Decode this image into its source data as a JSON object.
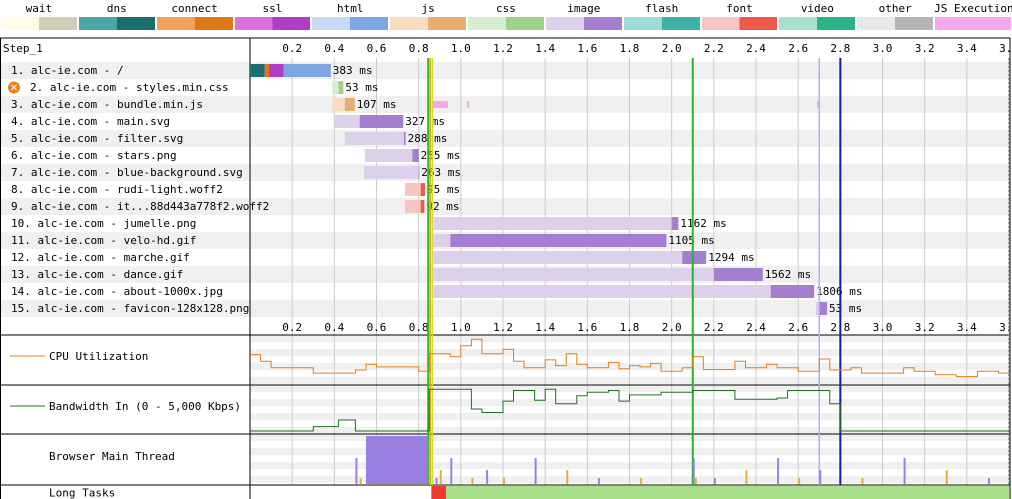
{
  "legend": [
    {
      "label": "wait",
      "colors": [
        "#fdfde7",
        "#cfcfb6"
      ]
    },
    {
      "label": "dns",
      "colors": [
        "#48a6a6",
        "#1b6f6f"
      ]
    },
    {
      "label": "connect",
      "colors": [
        "#f5a05a",
        "#e07614"
      ]
    },
    {
      "label": "ssl",
      "colors": [
        "#e06ee0",
        "#b23cc8"
      ]
    },
    {
      "label": "html",
      "colors": [
        "#c7d9f5",
        "#7ea6e0"
      ]
    },
    {
      "label": "js",
      "colors": [
        "#f7dcbf",
        "#e6ae72"
      ]
    },
    {
      "label": "css",
      "colors": [
        "#d7ecd0",
        "#9fd08e"
      ]
    },
    {
      "label": "image",
      "colors": [
        "#ddd0ea",
        "#a47fd0"
      ]
    },
    {
      "label": "flash",
      "colors": [
        "#9fdcd6",
        "#3fb0a4"
      ]
    },
    {
      "label": "font",
      "colors": [
        "#f8c6c0",
        "#ef5a48"
      ]
    },
    {
      "label": "video",
      "colors": [
        "#a8e0cc",
        "#2db38a"
      ]
    },
    {
      "label": "other",
      "colors": [
        "#e8e8e8",
        "#b5b5b5"
      ]
    },
    {
      "label": "JS Execution",
      "colors": [
        "#f6a6f0",
        "#f6a6f0"
      ]
    }
  ],
  "step_label": "Step_1",
  "chart_data": {
    "type": "waterfall",
    "x_unit": "s",
    "xlim": [
      0,
      3.6
    ],
    "ticks": [
      "0.2",
      "0.4",
      "0.6",
      "0.8",
      "1.0",
      "1.2",
      "1.4",
      "1.6",
      "1.8",
      "2.0",
      "2.2",
      "2.4",
      "2.6",
      "2.8",
      "3.0",
      "3.2",
      "3.4",
      "3.6"
    ],
    "tick_values": [
      0.2,
      0.4,
      0.6,
      0.8,
      1.0,
      1.2,
      1.4,
      1.6,
      1.8,
      2.0,
      2.2,
      2.4,
      2.6,
      2.8,
      3.0,
      3.2,
      3.4,
      3.6
    ],
    "markers": [
      {
        "name": "start-render",
        "time": 0.845,
        "color": "#28c028"
      },
      {
        "name": "first-paint",
        "time": 0.865,
        "color": "#c8e030"
      },
      {
        "name": "dom-interactive",
        "time": 0.855,
        "color": "#e8a020"
      },
      {
        "name": "dom-content-loaded",
        "time": 2.1,
        "color": "#28b428"
      },
      {
        "name": "on-load",
        "time": 2.7,
        "color": "#b0b0f0"
      },
      {
        "name": "document-complete",
        "time": 2.8,
        "color": "#1818a8"
      },
      {
        "name": "end",
        "time": 3.6,
        "color": "#888888"
      }
    ],
    "requests": [
      {
        "label": "1. alc-ie.com - /",
        "type": "html",
        "segments": [
          {
            "kind": "dns",
            "s": 0.0,
            "e": 0.07
          },
          {
            "kind": "connect",
            "s": 0.07,
            "e": 0.09
          },
          {
            "kind": "ssl",
            "s": 0.09,
            "e": 0.16
          },
          {
            "kind": "wait",
            "s": 0.16,
            "e": 0.16
          },
          {
            "kind": "recv",
            "s": 0.16,
            "e": 0.383
          }
        ],
        "ms": "383 ms",
        "end": 0.383,
        "blocked": false
      },
      {
        "label": "2. alc-ie.com - styles.min.css",
        "type": "css",
        "segments": [
          {
            "kind": "wait",
            "s": 0.39,
            "e": 0.42
          },
          {
            "kind": "recv",
            "s": 0.42,
            "e": 0.443
          }
        ],
        "ms": "53 ms",
        "end": 0.443,
        "blocked": true
      },
      {
        "label": "3. alc-ie.com - bundle.min.js",
        "type": "js",
        "segments": [
          {
            "kind": "wait",
            "s": 0.39,
            "e": 0.45
          },
          {
            "kind": "recv",
            "s": 0.45,
            "e": 0.497
          }
        ],
        "ms": "107 ms",
        "end": 0.497,
        "blocked": false
      },
      {
        "label": "4. alc-ie.com - main.svg",
        "type": "image",
        "segments": [
          {
            "kind": "wait",
            "s": 0.4,
            "e": 0.52
          },
          {
            "kind": "recv",
            "s": 0.52,
            "e": 0.727
          }
        ],
        "ms": "327 ms",
        "end": 0.727,
        "blocked": false
      },
      {
        "label": "5. alc-ie.com - filter.svg",
        "type": "image",
        "segments": [
          {
            "kind": "wait",
            "s": 0.45,
            "e": 0.73
          },
          {
            "kind": "recv",
            "s": 0.73,
            "e": 0.738
          }
        ],
        "ms": "288 ms",
        "end": 0.738,
        "blocked": false
      },
      {
        "label": "6. alc-ie.com - stars.png",
        "type": "image",
        "segments": [
          {
            "kind": "wait",
            "s": 0.545,
            "e": 0.77
          },
          {
            "kind": "recv",
            "s": 0.77,
            "e": 0.8
          }
        ],
        "ms": "255 ms",
        "end": 0.8,
        "blocked": false
      },
      {
        "label": "7. alc-ie.com - blue-background.svg",
        "type": "image",
        "segments": [
          {
            "kind": "wait",
            "s": 0.54,
            "e": 0.8
          },
          {
            "kind": "recv",
            "s": 0.8,
            "e": 0.803
          }
        ],
        "ms": "263 ms",
        "end": 0.803,
        "blocked": false
      },
      {
        "label": "8. alc-ie.com - rudi-light.woff2",
        "type": "font",
        "segments": [
          {
            "kind": "wait",
            "s": 0.735,
            "e": 0.81
          },
          {
            "kind": "recv",
            "s": 0.81,
            "e": 0.83
          }
        ],
        "ms": "95 ms",
        "end": 0.83,
        "blocked": false
      },
      {
        "label": "9. alc-ie.com - it...88d443a778f2.woff2",
        "type": "font",
        "segments": [
          {
            "kind": "wait",
            "s": 0.735,
            "e": 0.81
          },
          {
            "kind": "recv",
            "s": 0.81,
            "e": 0.827
          }
        ],
        "ms": "92 ms",
        "end": 0.827,
        "blocked": false
      },
      {
        "label": "10. alc-ie.com - jumelle.png",
        "type": "image",
        "segments": [
          {
            "kind": "wait",
            "s": 0.87,
            "e": 2.0
          },
          {
            "kind": "recv",
            "s": 2.0,
            "e": 2.032
          }
        ],
        "ms": "1162 ms",
        "end": 2.032,
        "blocked": false
      },
      {
        "label": "11. alc-ie.com - velo-hd.gif",
        "type": "image",
        "segments": [
          {
            "kind": "wait",
            "s": 0.87,
            "e": 0.95
          },
          {
            "kind": "recv",
            "s": 0.95,
            "e": 1.975
          }
        ],
        "ms": "1105 ms",
        "end": 1.975,
        "blocked": false
      },
      {
        "label": "12. alc-ie.com - marche.gif",
        "type": "image",
        "segments": [
          {
            "kind": "wait",
            "s": 0.87,
            "e": 2.05
          },
          {
            "kind": "recv",
            "s": 2.05,
            "e": 2.164
          }
        ],
        "ms": "1294 ms",
        "end": 2.164,
        "blocked": false
      },
      {
        "label": "13. alc-ie.com - dance.gif",
        "type": "image",
        "segments": [
          {
            "kind": "wait",
            "s": 0.87,
            "e": 2.2
          },
          {
            "kind": "recv",
            "s": 2.2,
            "e": 2.432
          }
        ],
        "ms": "1562 ms",
        "end": 2.432,
        "blocked": false
      },
      {
        "label": "14. alc-ie.com - about-1000x.jpg",
        "type": "image",
        "segments": [
          {
            "kind": "wait",
            "s": 0.87,
            "e": 2.47
          },
          {
            "kind": "recv",
            "s": 2.47,
            "e": 2.676
          }
        ],
        "ms": "1806 ms",
        "end": 2.676,
        "blocked": false
      },
      {
        "label": "15. alc-ie.com - favicon-128x128.png",
        "type": "image",
        "segments": [
          {
            "kind": "wait",
            "s": 2.684,
            "e": 2.7
          },
          {
            "kind": "recv",
            "s": 2.7,
            "e": 2.737
          }
        ],
        "ms": "53 ms",
        "end": 2.737,
        "blocked": false
      }
    ],
    "js_execution": [
      {
        "s": 0.865,
        "e": 0.94
      },
      {
        "s": 1.03,
        "e": 1.04
      },
      {
        "s": 2.69,
        "e": 2.7
      }
    ],
    "cpu_utilization": {
      "label": "CPU Utilization",
      "color": "#e07f18",
      "points": [
        [
          0,
          60
        ],
        [
          0.05,
          60
        ],
        [
          0.05,
          45
        ],
        [
          0.1,
          45
        ],
        [
          0.1,
          30
        ],
        [
          0.3,
          30
        ],
        [
          0.3,
          18
        ],
        [
          0.5,
          18
        ],
        [
          0.5,
          25
        ],
        [
          0.55,
          25
        ],
        [
          0.55,
          38
        ],
        [
          0.6,
          38
        ],
        [
          0.6,
          32
        ],
        [
          0.8,
          32
        ],
        [
          0.8,
          22
        ],
        [
          0.85,
          22
        ],
        [
          0.85,
          62
        ],
        [
          0.95,
          62
        ],
        [
          0.95,
          55
        ],
        [
          1.0,
          55
        ],
        [
          1.0,
          80
        ],
        [
          1.05,
          80
        ],
        [
          1.05,
          95
        ],
        [
          1.1,
          95
        ],
        [
          1.1,
          62
        ],
        [
          1.2,
          62
        ],
        [
          1.2,
          72
        ],
        [
          1.25,
          72
        ],
        [
          1.25,
          45
        ],
        [
          1.3,
          45
        ],
        [
          1.3,
          30
        ],
        [
          1.4,
          30
        ],
        [
          1.4,
          48
        ],
        [
          1.45,
          48
        ],
        [
          1.45,
          35
        ],
        [
          1.5,
          35
        ],
        [
          1.5,
          62
        ],
        [
          1.55,
          62
        ],
        [
          1.55,
          38
        ],
        [
          1.6,
          38
        ],
        [
          1.6,
          30
        ],
        [
          1.7,
          30
        ],
        [
          1.7,
          42
        ],
        [
          1.75,
          42
        ],
        [
          1.75,
          28
        ],
        [
          1.8,
          28
        ],
        [
          1.8,
          35
        ],
        [
          1.85,
          35
        ],
        [
          1.85,
          32
        ],
        [
          1.9,
          32
        ],
        [
          1.9,
          40
        ],
        [
          1.95,
          40
        ],
        [
          1.95,
          22
        ],
        [
          2.05,
          22
        ],
        [
          2.05,
          30
        ],
        [
          2.1,
          30
        ],
        [
          2.1,
          55
        ],
        [
          2.15,
          55
        ],
        [
          2.15,
          26
        ],
        [
          2.3,
          26
        ],
        [
          2.3,
          45
        ],
        [
          2.35,
          45
        ],
        [
          2.35,
          30
        ],
        [
          2.45,
          30
        ],
        [
          2.45,
          38
        ],
        [
          2.5,
          38
        ],
        [
          2.5,
          30
        ],
        [
          2.6,
          30
        ],
        [
          2.6,
          22
        ],
        [
          2.7,
          22
        ],
        [
          2.7,
          50
        ],
        [
          2.75,
          50
        ],
        [
          2.75,
          25
        ],
        [
          2.85,
          25
        ],
        [
          2.85,
          30
        ],
        [
          2.9,
          30
        ],
        [
          2.9,
          18
        ],
        [
          3.1,
          18
        ],
        [
          3.1,
          30
        ],
        [
          3.15,
          30
        ],
        [
          3.15,
          22
        ],
        [
          3.25,
          22
        ],
        [
          3.25,
          14
        ],
        [
          3.35,
          14
        ],
        [
          3.35,
          10
        ],
        [
          3.45,
          10
        ],
        [
          3.45,
          22
        ],
        [
          3.55,
          22
        ],
        [
          3.55,
          18
        ],
        [
          3.6,
          18
        ]
      ]
    },
    "bandwidth_in": {
      "label": "Bandwidth In (0 - 5,000 Kbps)",
      "color": "#207020",
      "points": [
        [
          0,
          0
        ],
        [
          0.3,
          0
        ],
        [
          0.3,
          10
        ],
        [
          0.42,
          10
        ],
        [
          0.42,
          25
        ],
        [
          0.5,
          25
        ],
        [
          0.5,
          0
        ],
        [
          0.85,
          0
        ],
        [
          0.85,
          95
        ],
        [
          1.05,
          95
        ],
        [
          1.05,
          50
        ],
        [
          1.1,
          50
        ],
        [
          1.1,
          42
        ],
        [
          1.2,
          42
        ],
        [
          1.2,
          68
        ],
        [
          1.25,
          68
        ],
        [
          1.25,
          92
        ],
        [
          1.35,
          92
        ],
        [
          1.35,
          70
        ],
        [
          1.4,
          70
        ],
        [
          1.4,
          95
        ],
        [
          1.45,
          95
        ],
        [
          1.45,
          62
        ],
        [
          1.55,
          62
        ],
        [
          1.55,
          80
        ],
        [
          1.6,
          80
        ],
        [
          1.6,
          88
        ],
        [
          1.7,
          88
        ],
        [
          1.7,
          92
        ],
        [
          1.75,
          92
        ],
        [
          1.75,
          68
        ],
        [
          1.8,
          68
        ],
        [
          1.8,
          82
        ],
        [
          1.95,
          82
        ],
        [
          1.95,
          88
        ],
        [
          2.1,
          88
        ],
        [
          2.1,
          92
        ],
        [
          2.3,
          92
        ],
        [
          2.3,
          72
        ],
        [
          2.5,
          72
        ],
        [
          2.5,
          75
        ],
        [
          2.55,
          75
        ],
        [
          2.55,
          92
        ],
        [
          2.75,
          92
        ],
        [
          2.75,
          62
        ],
        [
          2.8,
          62
        ],
        [
          2.8,
          0
        ],
        [
          3.6,
          0
        ]
      ]
    },
    "main_thread_label": "Browser Main Thread",
    "long_tasks_label": "Long Tasks",
    "long_tasks": [
      {
        "s": 0.86,
        "e": 0.93,
        "kind": "long"
      },
      {
        "s": 0.93,
        "e": 3.6,
        "kind": "ok"
      }
    ]
  }
}
